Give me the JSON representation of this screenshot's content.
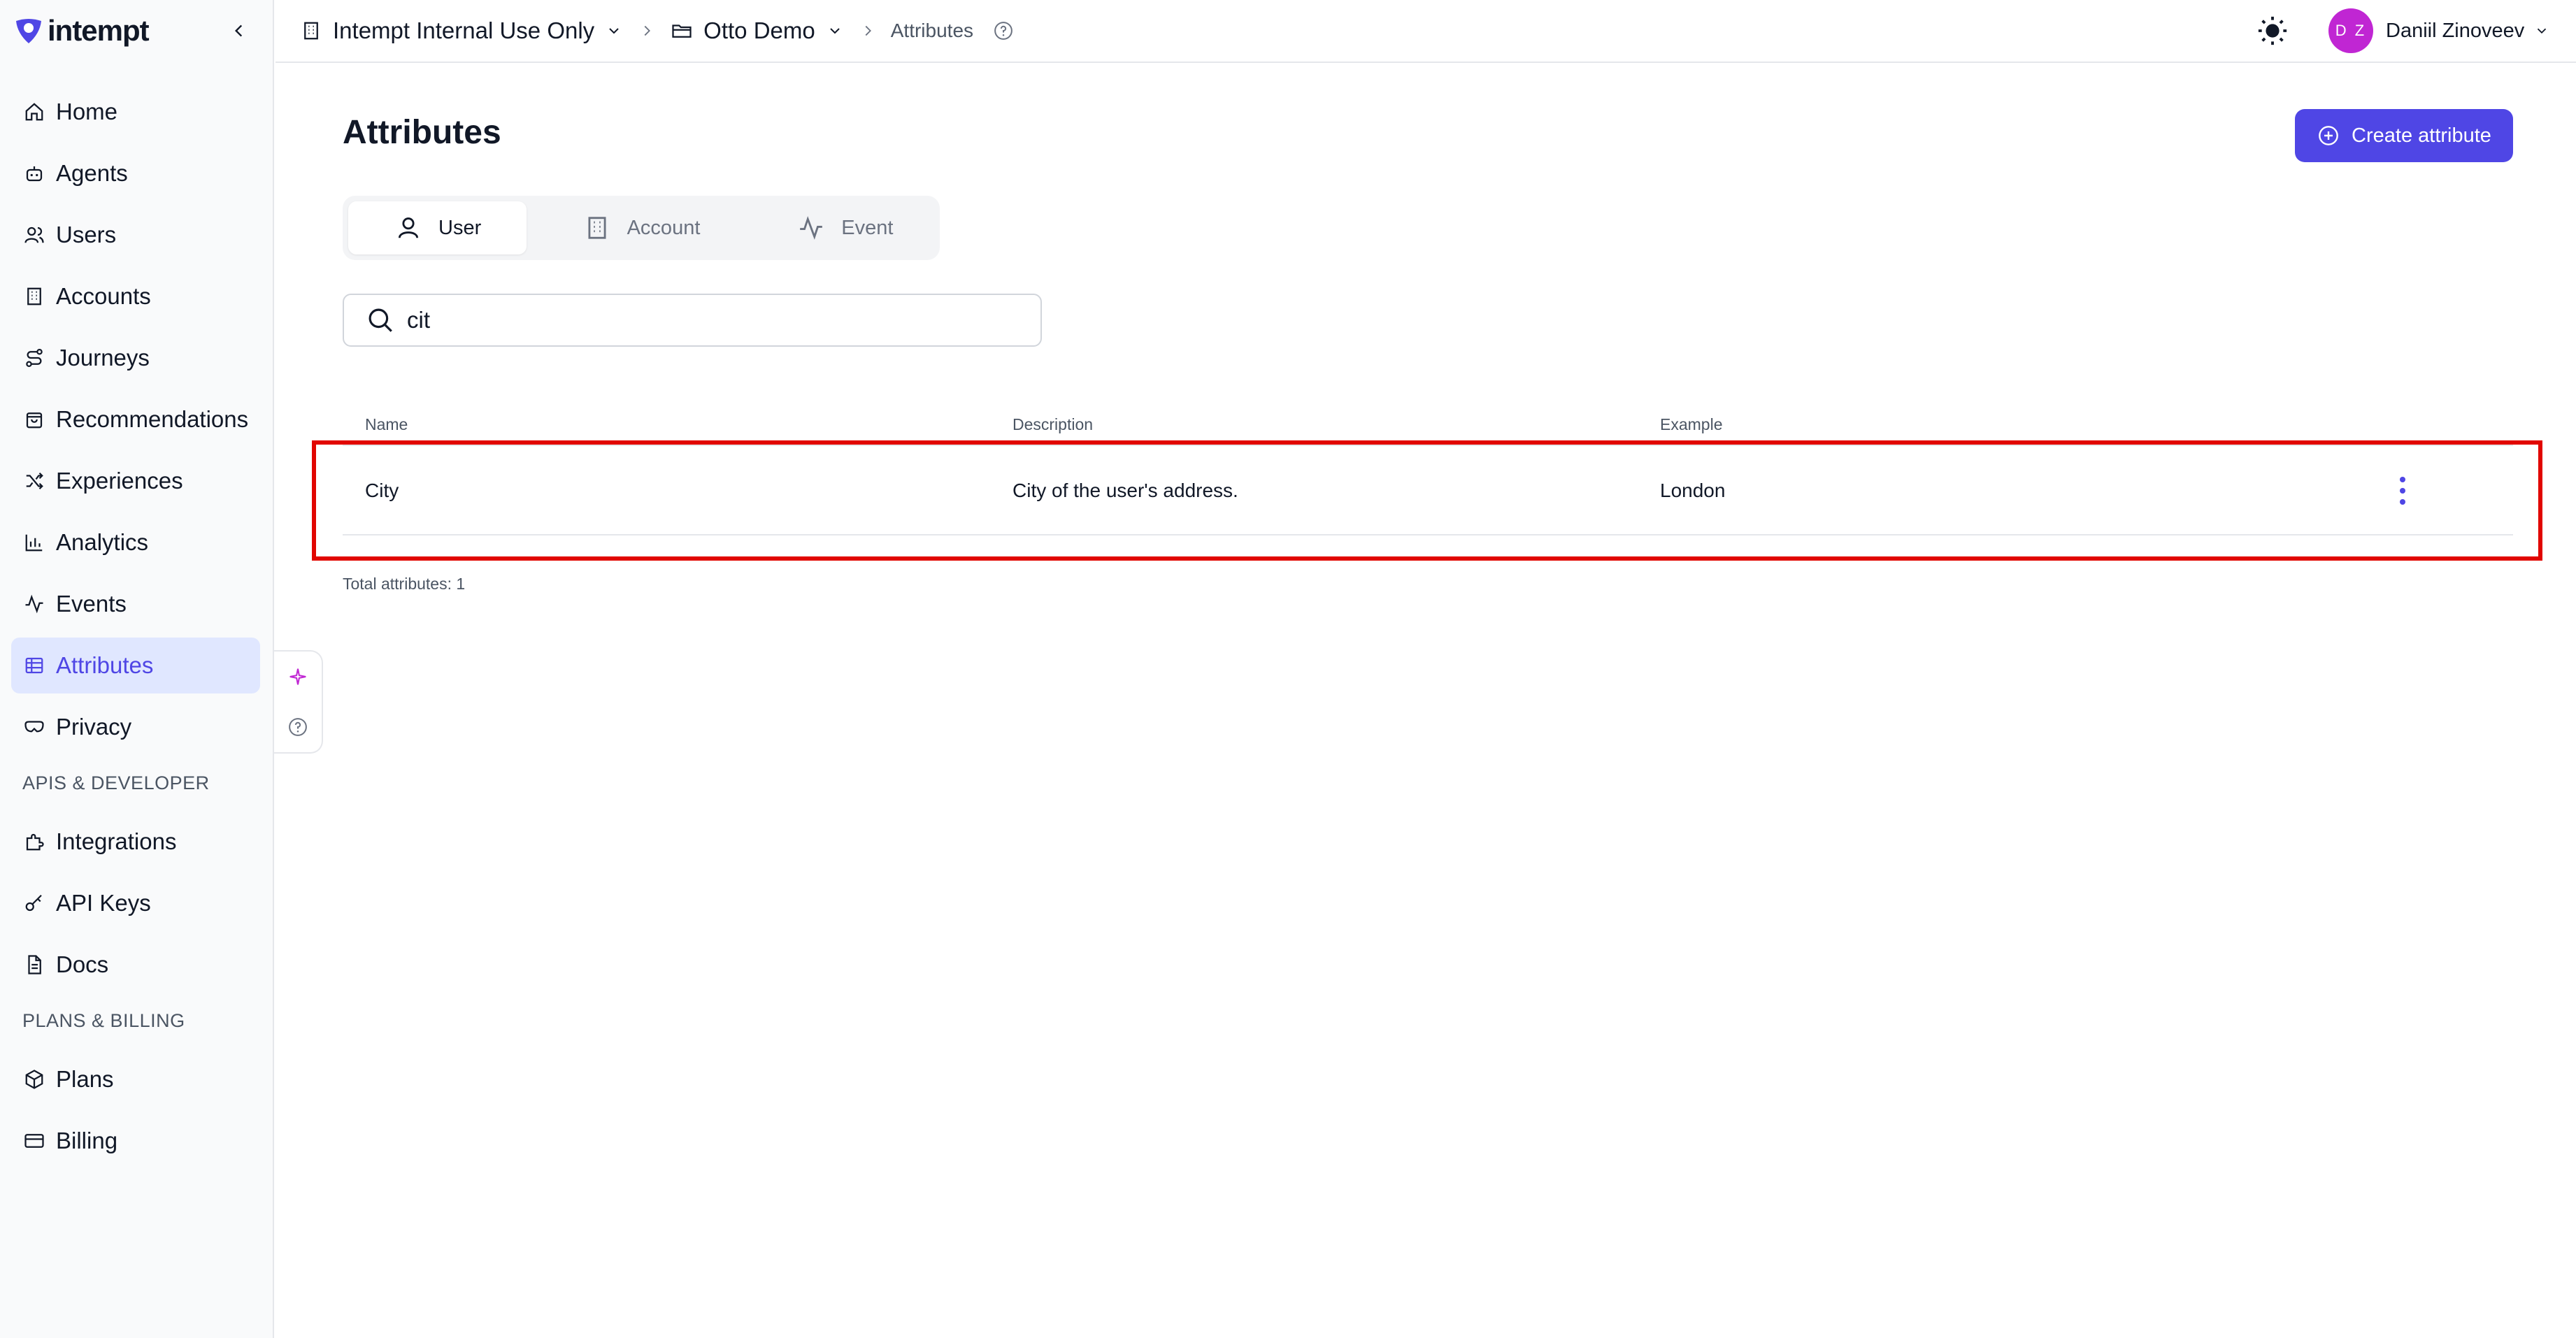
{
  "brand": {
    "name": "intempt",
    "color": "#4f46e5"
  },
  "sidebar": {
    "items": [
      {
        "label": "Home",
        "icon": "home-icon"
      },
      {
        "label": "Agents",
        "icon": "bot-icon"
      },
      {
        "label": "Users",
        "icon": "users-icon"
      },
      {
        "label": "Accounts",
        "icon": "building-icon"
      },
      {
        "label": "Journeys",
        "icon": "route-icon"
      },
      {
        "label": "Recommendations",
        "icon": "shopping-bag-icon"
      },
      {
        "label": "Experiences",
        "icon": "shuffle-icon"
      },
      {
        "label": "Analytics",
        "icon": "bar-chart-icon"
      },
      {
        "label": "Events",
        "icon": "activity-icon"
      },
      {
        "label": "Attributes",
        "icon": "table-icon",
        "active": true
      },
      {
        "label": "Privacy",
        "icon": "mask-icon"
      }
    ],
    "section_dev": "APIS & DEVELOPER",
    "dev_items": [
      {
        "label": "Integrations",
        "icon": "puzzle-icon"
      },
      {
        "label": "API Keys",
        "icon": "key-icon"
      },
      {
        "label": "Docs",
        "icon": "document-icon"
      }
    ],
    "section_billing": "PLANS & BILLING",
    "billing_items": [
      {
        "label": "Plans",
        "icon": "package-icon"
      },
      {
        "label": "Billing",
        "icon": "credit-card-icon"
      }
    ]
  },
  "topbar": {
    "org": "Intempt Internal Use Only",
    "project": "Otto Demo",
    "page": "Attributes",
    "user_initials": "D Z",
    "user_name": "Daniil Zinoveev"
  },
  "main": {
    "title": "Attributes",
    "create_label": "Create attribute",
    "tabs": [
      {
        "label": "User",
        "icon": "user-icon",
        "active": true
      },
      {
        "label": "Account",
        "icon": "building-icon"
      },
      {
        "label": "Event",
        "icon": "activity-icon"
      }
    ],
    "search_value": "cit",
    "columns": {
      "name": "Name",
      "description": "Description",
      "example": "Example"
    },
    "rows": [
      {
        "name": "City",
        "description": "City of the user's address.",
        "example": "London"
      }
    ],
    "total": "Total attributes: 1"
  },
  "colors": {
    "accent": "#4f46e5",
    "active_bg": "#e0e7ff",
    "highlight": "#e10600",
    "avatar": "#c026d3"
  }
}
